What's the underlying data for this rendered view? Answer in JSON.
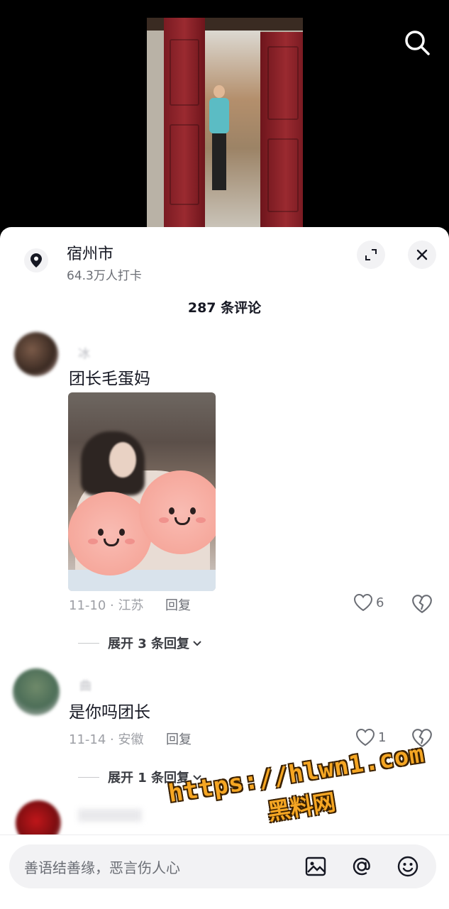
{
  "location": {
    "title": "宿州市",
    "subtitle": "64.3万人打卡"
  },
  "comments_header": {
    "count_label": "287 条评论"
  },
  "comments": [
    {
      "username": "冰",
      "text": "团长毛蛋妈",
      "has_image": true,
      "date": "11-10",
      "region": "江苏",
      "meta": "11-10 · 江苏",
      "reply_label": "回复",
      "likes": "6",
      "expand_label": "展开 3 条回复"
    },
    {
      "username": "曲",
      "text": "是你吗团长",
      "has_image": false,
      "date": "11-14",
      "region": "安徽",
      "meta": "11-14 · 安徽",
      "reply_label": "回复",
      "likes": "1",
      "expand_label": "展开 1 条回复"
    }
  ],
  "watermark": {
    "url": "https://hlwn1.com",
    "name": "黑料网"
  },
  "composer": {
    "placeholder": "善语结善缘，恶言伤人心"
  },
  "icons": {
    "search": "search-icon",
    "location": "location-pin-icon",
    "expand": "expand-icon",
    "close": "close-icon",
    "like": "heart-icon",
    "dislike": "broken-heart-icon",
    "chevron": "chevron-down-icon",
    "image": "image-icon",
    "mention": "at-icon",
    "emoji": "emoji-icon"
  },
  "colors": {
    "accent_watermark": "#f5a623",
    "text_primary": "#161823",
    "text_secondary": "#6b6e75"
  }
}
